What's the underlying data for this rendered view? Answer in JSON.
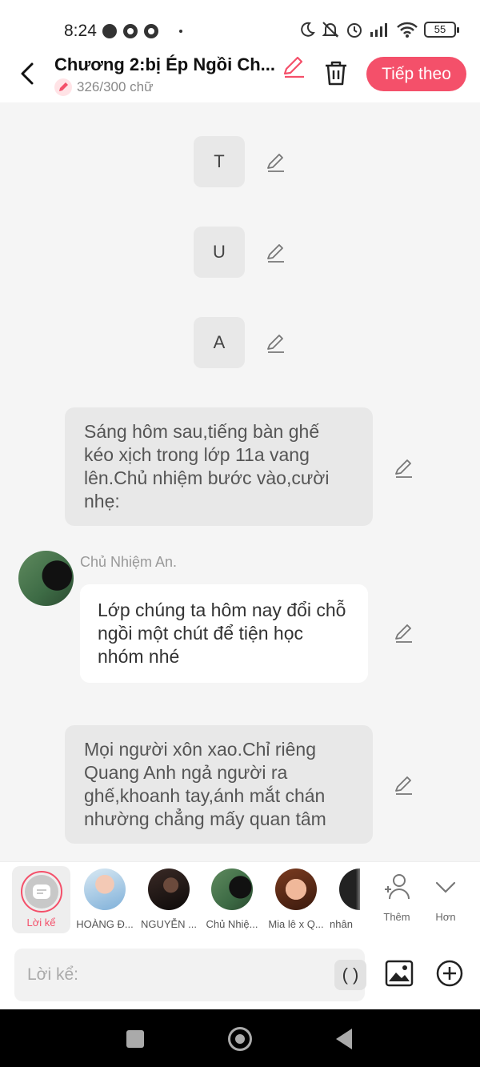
{
  "status_bar": {
    "time": "8:24",
    "battery": "55"
  },
  "header": {
    "title": "Chương 2:bị Ép Ngồi Ch...",
    "word_count": "326/300 chữ",
    "next_label": "Tiếp theo",
    "accent_color": "#f4506a"
  },
  "letters": [
    "T",
    "U",
    "A"
  ],
  "messages": {
    "narration_1": "Sáng hôm sau,tiếng bàn ghế kéo xịch trong lớp 11a vang lên.Chủ nhiệm bước vào,cười nhẹ:",
    "speaker_name": "Chủ Nhiệm An.",
    "speech_1": "Lớp chúng ta hôm nay đổi chỗ ngồi một chút để tiện học nhóm nhé",
    "narration_2": "Mọi người xôn xao.Chỉ riêng Quang Anh ngả người ra ghế,khoanh tay,ánh mắt chán nhường chẳng mấy quan tâm"
  },
  "characters": {
    "narrator": "Lời kể",
    "list": [
      "HOÀNG Đ...",
      "NGUYỄN ...",
      "Chủ Nhiệ...",
      "Mia lê x Q...",
      "nhân"
    ],
    "add_label": "Thêm",
    "more_label": "Hơn"
  },
  "input": {
    "placeholder": "Lời kể:",
    "paren_label": "( )"
  }
}
